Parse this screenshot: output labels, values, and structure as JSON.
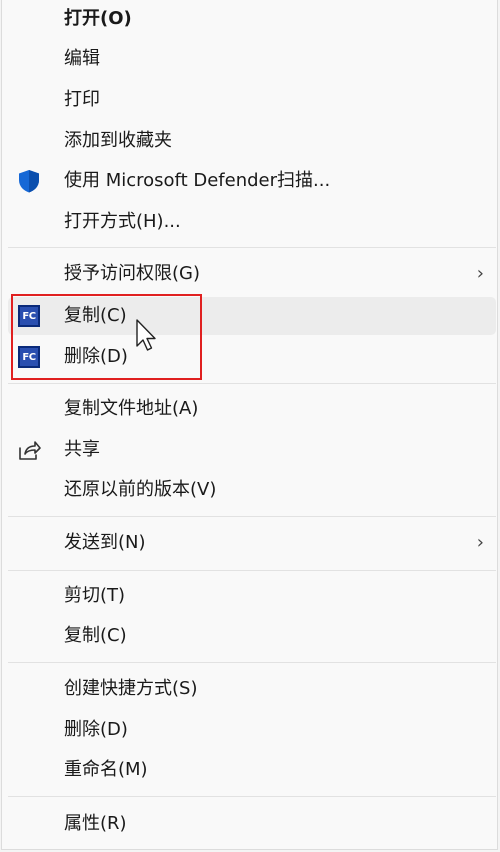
{
  "menu": {
    "group1": {
      "open": "打开(O)",
      "edit": "编辑",
      "print": "打印",
      "add_favorites": "添加到收藏夹",
      "defender_scan": "使用 Microsoft Defender扫描...",
      "open_with": "打开方式(H)..."
    },
    "group2": {
      "grant_access": "授予访问权限(G)",
      "fc_copy": "复制(C)",
      "fc_delete": "删除(D)",
      "fc_icon_text": "FC"
    },
    "group3": {
      "copy_path": "复制文件地址(A)",
      "share": "共享",
      "restore_versions": "还原以前的版本(V)"
    },
    "group4": {
      "send_to": "发送到(N)"
    },
    "group5": {
      "cut": "剪切(T)",
      "copy": "复制(C)"
    },
    "group6": {
      "create_shortcut": "创建快捷方式(S)",
      "delete": "删除(D)",
      "rename": "重命名(M)"
    },
    "group7": {
      "properties": "属性(R)"
    },
    "submenu_chevron": "›"
  },
  "colors": {
    "highlight_border": "#e02020",
    "defender_shield": "#1668d6",
    "fc_icon_bg": "#2a4fb0"
  },
  "icons": {
    "defender": "shield-icon",
    "share": "share-icon",
    "fc": "fc-app-icon",
    "cursor": "mouse-pointer-icon"
  }
}
